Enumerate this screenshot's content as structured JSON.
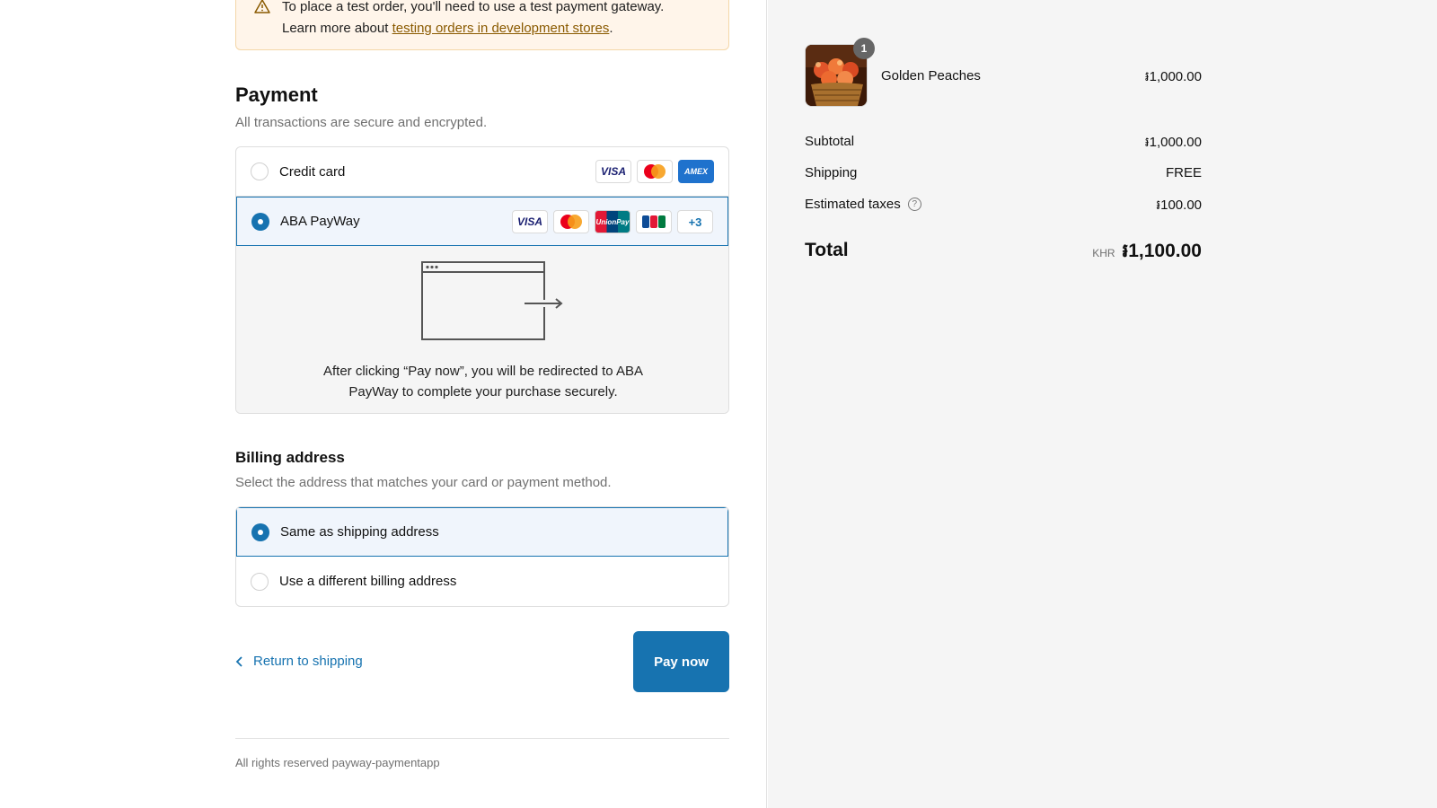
{
  "banner": {
    "line1": "To place a test order, you'll need to use a test payment gateway.",
    "line2_prefix": "Learn more about ",
    "link": "testing orders in development stores",
    "line2_suffix": "."
  },
  "payment": {
    "title": "Payment",
    "subtitle": "All transactions are secure and encrypted.",
    "methods": [
      {
        "label": "Credit card",
        "selected": false,
        "cards": [
          "VISA",
          "mastercard",
          "AMEX"
        ]
      },
      {
        "label": "ABA PayWay",
        "selected": true,
        "cards": [
          "VISA",
          "mastercard",
          "UnionPay",
          "JCB",
          "+3"
        ]
      }
    ],
    "redirect_text_1": "After clicking “Pay now”, you will be redirected to ABA",
    "redirect_text_2": "PayWay to complete your purchase securely."
  },
  "billing": {
    "title": "Billing address",
    "subtitle": "Select the address that matches your card or payment method.",
    "options": [
      {
        "label": "Same as shipping address",
        "selected": true
      },
      {
        "label": "Use a different billing address",
        "selected": false
      }
    ]
  },
  "actions": {
    "back_label": "Return to shipping",
    "pay_label": "Pay now"
  },
  "footer": {
    "text": "All rights reserved payway-paymentapp"
  },
  "summary": {
    "item": {
      "name": "Golden Peaches",
      "quantity": "1",
      "price": "៛1,000.00"
    },
    "subtotal_label": "Subtotal",
    "subtotal": "៛1,000.00",
    "shipping_label": "Shipping",
    "shipping": "FREE",
    "taxes_label": "Estimated taxes",
    "taxes": "៛100.00",
    "total_label": "Total",
    "currency": "KHR",
    "total": "៛1,100.00"
  },
  "colors": {
    "accent": "#1773b0",
    "banner_bg": "#fff5ea",
    "summary_bg": "#f5f5f5"
  }
}
